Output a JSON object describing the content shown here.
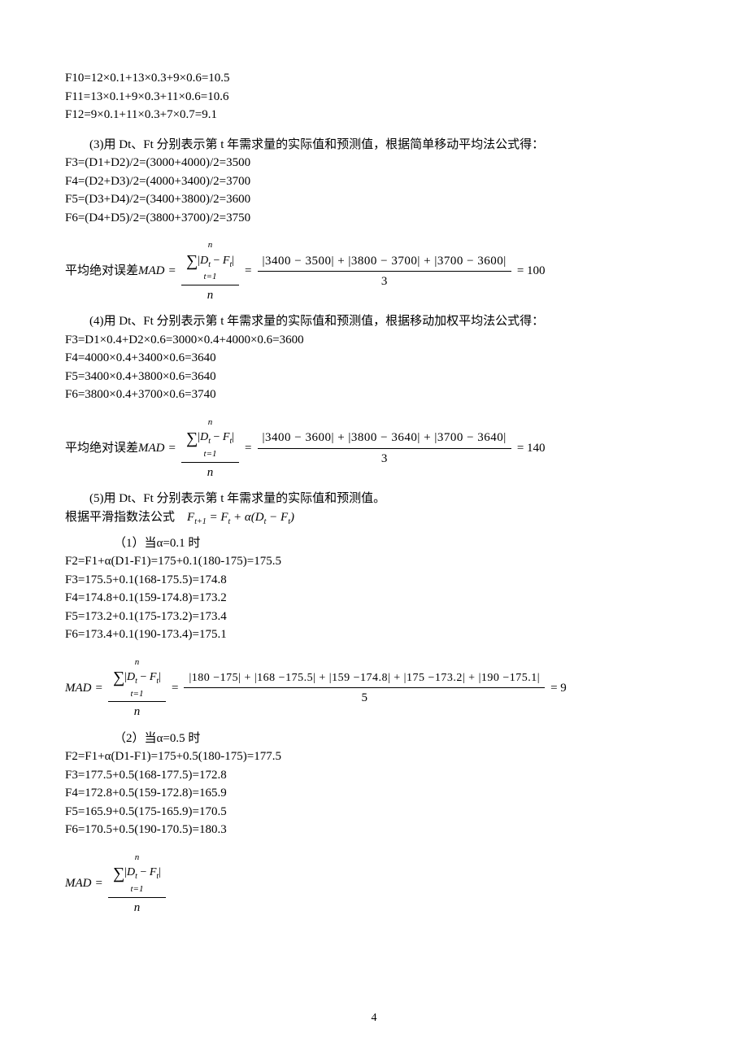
{
  "top": {
    "l1": "F10=12×0.1+13×0.3+9×0.6=10.5",
    "l2": "F11=13×0.1+9×0.3+11×0.6=10.6",
    "l3": "F12=9×0.1+11×0.3+7×0.7=9.1"
  },
  "q3": {
    "intro": "(3)用 Dt、Ft 分别表示第 t 年需求量的实际值和预测值，根据简单移动平均法公式得：",
    "l1": "F3=(D1+D2)/2=(3000+4000)/2=3500",
    "l2": "F4=(D2+D3)/2=(4000+3400)/2=3700",
    "l3": "F5=(D3+D4)/2=(3400+3800)/2=3600",
    "l4": "F6=(D4+D5)/2=(3800+3700)/2=3750"
  },
  "mad1": {
    "prefix": "平均绝对误差",
    "label": "MAD",
    "sum_top": "n",
    "sum_bottom": "t=1",
    "sum_body": "|D_t − F_t|",
    "den": "n",
    "expand_num": "|3400 − 3500| + |3800 − 3700| + |3700 − 3600|",
    "expand_den": "3",
    "result": "= 100"
  },
  "q4": {
    "intro": "(4)用 Dt、Ft 分别表示第 t 年需求量的实际值和预测值，根据移动加权平均法公式得：",
    "l1": "F3=D1×0.4+D2×0.6=3000×0.4+4000×0.6=3600",
    "l2": "F4=4000×0.4+3400×0.6=3640",
    "l3": "F5=3400×0.4+3800×0.6=3640",
    "l4": "F6=3800×0.4+3700×0.6=3740"
  },
  "mad2": {
    "prefix": "平均绝对误差",
    "label": "MAD",
    "expand_num": "|3400 − 3600| + |3800 − 3640| + |3700 − 3640|",
    "expand_den": "3",
    "result": "= 140"
  },
  "q5": {
    "intro": "(5)用 Dt、Ft 分别表示第 t 年需求量的实际值和预测值。",
    "formula_prefix": "根据平滑指数法公式",
    "formula": "F_{t+1} = F_t + α(D_t − F_t)"
  },
  "q5a": {
    "heading": "（1）当α=0.1 时",
    "l1": "F2=F1+α(D1-F1)=175+0.1(180-175)=175.5",
    "l2": "F3=175.5+0.1(168-175.5)=174.8",
    "l3": "F4=174.8+0.1(159-174.8)=173.2",
    "l4": "F5=173.2+0.1(175-173.2)=173.4",
    "l5": "F6=173.4+0.1(190-173.4)=175.1"
  },
  "mad3": {
    "label": "MAD",
    "expand_num": "|180 −175| + |168 −175.5| + |159 −174.8| + |175 −173.2| + |190 −175.1|",
    "expand_den": "5",
    "result": "= 9"
  },
  "q5b": {
    "heading": "（2）当α=0.5 时",
    "l1": "F2=F1+α(D1-F1)=175+0.5(180-175)=177.5",
    "l2": "F3=177.5+0.5(168-177.5)=172.8",
    "l3": "F4=172.8+0.5(159-172.8)=165.9",
    "l4": "F5=165.9+0.5(175-165.9)=170.5",
    "l5": "F6=170.5+0.5(190-170.5)=180.3"
  },
  "mad4": {
    "label": "MAD"
  },
  "pagenum": "4"
}
